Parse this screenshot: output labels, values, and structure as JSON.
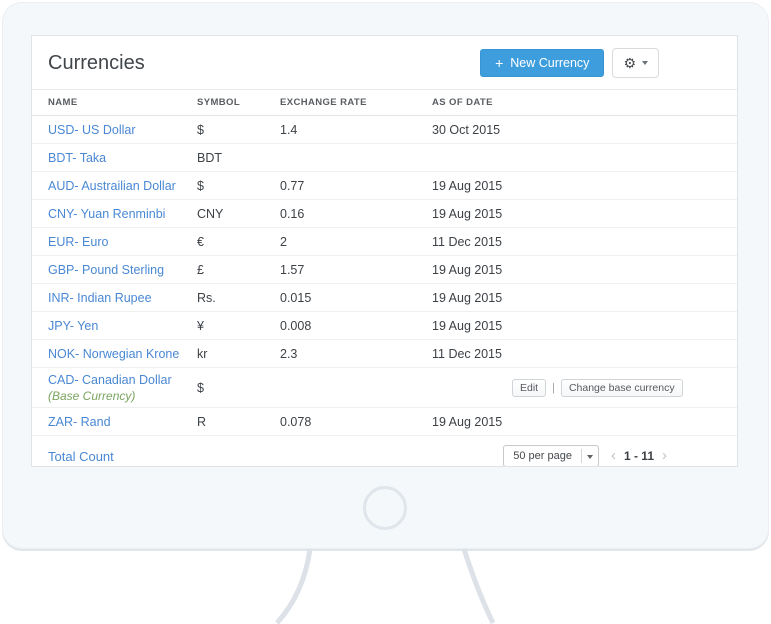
{
  "window": {
    "title": "Currencies"
  },
  "header": {
    "new_currency_label": "New Currency",
    "plus_icon": "+",
    "gear_icon": "⚙"
  },
  "table": {
    "columns": [
      "NAME",
      "SYMBOL",
      "EXCHANGE RATE",
      "AS OF DATE"
    ],
    "action_separator": "|",
    "rows": [
      {
        "name": "USD- US Dollar",
        "symbol": "$",
        "rate": "1.4",
        "date": "30 Oct 2015"
      },
      {
        "name": "BDT- Taka",
        "symbol": "BDT",
        "rate": "",
        "date": ""
      },
      {
        "name": "AUD- Austrailian Dollar",
        "symbol": "$",
        "rate": "0.77",
        "date": "19 Aug 2015"
      },
      {
        "name": "CNY- Yuan Renminbi",
        "symbol": "CNY",
        "rate": "0.16",
        "date": "19 Aug 2015"
      },
      {
        "name": "EUR- Euro",
        "symbol": "€",
        "rate": "2",
        "date": "11 Dec 2015"
      },
      {
        "name": "GBP- Pound Sterling",
        "symbol": "£",
        "rate": "1.57",
        "date": "19 Aug 2015"
      },
      {
        "name": "INR- Indian Rupee",
        "symbol": "Rs.",
        "rate": "0.015",
        "date": "19 Aug 2015"
      },
      {
        "name": "JPY- Yen",
        "symbol": "¥",
        "rate": "0.008",
        "date": "19 Aug 2015"
      },
      {
        "name": "NOK- Norwegian Krone",
        "symbol": "kr",
        "rate": "2.3",
        "date": "11 Dec 2015"
      },
      {
        "name": "CAD- Canadian Dollar",
        "symbol": "$",
        "rate": "",
        "date": "",
        "base_label": "(Base Currency)",
        "actions": [
          "Edit",
          "Change base currency"
        ]
      },
      {
        "name": "ZAR- Rand",
        "symbol": "R",
        "rate": "0.078",
        "date": "19 Aug 2015"
      }
    ]
  },
  "footer": {
    "total_count_label": "Total Count",
    "per_page_value": "50 per page",
    "range_label": "1 - 11",
    "prev_icon": "‹",
    "next_icon": "›"
  },
  "colors": {
    "accent_blue": "#3e9edd",
    "link_blue": "#4a88d4",
    "base_currency_green": "#7aa45f",
    "monitor_bezel": "#f4f8fb"
  }
}
